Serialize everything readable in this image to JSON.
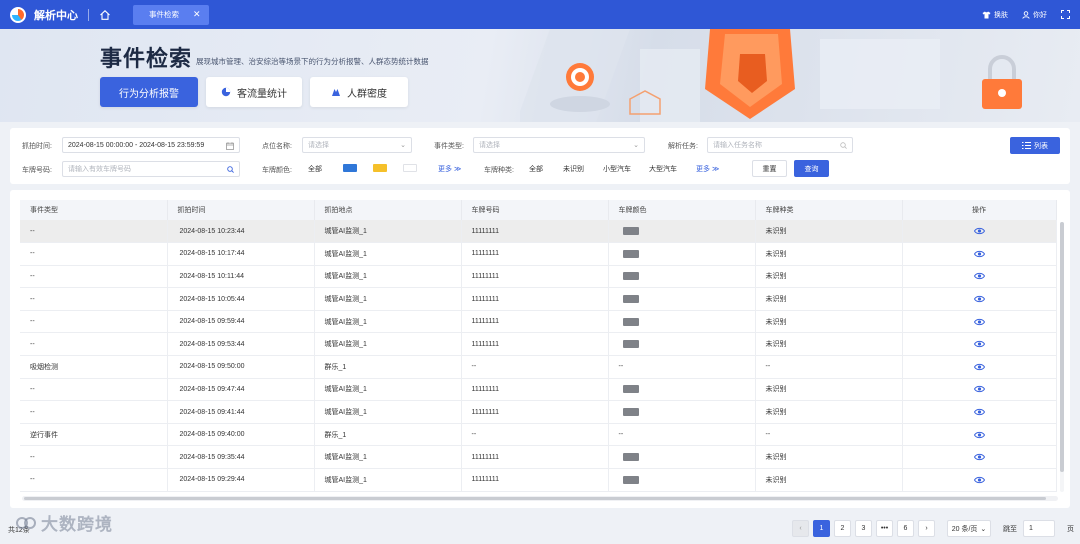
{
  "app": {
    "title": "解析中心",
    "active_tab": "事件检索"
  },
  "topbar": {
    "skin_label": "换肤",
    "user_label": "你好"
  },
  "banner": {
    "title": "事件检索",
    "subtitle": "展现城市管理、治安综治等场景下的行为分析报警、人群态势统计数据",
    "buttons": [
      "行为分析报警",
      "客流量统计",
      "人群密度"
    ]
  },
  "filters": {
    "time_label": "抓拍时间:",
    "time_value": "2024-08-15 00:00:00 - 2024-08-15 23:59:59",
    "point_label": "点位名称:",
    "point_placeholder": "请选择",
    "event_type_label": "事件类型:",
    "event_type_placeholder": "请选择",
    "task_label": "解析任务:",
    "task_placeholder": "请输入任务名称",
    "plate_label": "车牌号码:",
    "plate_placeholder": "请输入有效车牌号码",
    "plate_color_label": "车牌颜色:",
    "plate_color_all": "全部",
    "plate_colors": [
      "#2f77d8",
      "#f5c02a",
      "#ffffff"
    ],
    "more_label": "更多",
    "plate_kind_label": "车牌种类:",
    "plate_kinds": [
      "全部",
      "未识别",
      "小型汽车",
      "大型汽车"
    ],
    "reset_label": "重置",
    "search_label": "查询",
    "list_label": "列表"
  },
  "table": {
    "columns": [
      "事件类型",
      "抓拍时间",
      "抓拍地点",
      "车牌号码",
      "车牌颜色",
      "车牌种类",
      "操作"
    ],
    "rows": [
      {
        "type": "--",
        "time": "2024-08-15 10:23:44",
        "place": "城管AI监测_1",
        "plate": "11111111",
        "plate_color": true,
        "kind": "未识别"
      },
      {
        "type": "--",
        "time": "2024-08-15 10:17:44",
        "place": "城管AI监测_1",
        "plate": "11111111",
        "plate_color": true,
        "kind": "未识别"
      },
      {
        "type": "--",
        "time": "2024-08-15 10:11:44",
        "place": "城管AI监测_1",
        "plate": "11111111",
        "plate_color": true,
        "kind": "未识别"
      },
      {
        "type": "--",
        "time": "2024-08-15 10:05:44",
        "place": "城管AI监测_1",
        "plate": "11111111",
        "plate_color": true,
        "kind": "未识别"
      },
      {
        "type": "--",
        "time": "2024-08-15 09:59:44",
        "place": "城管AI监测_1",
        "plate": "11111111",
        "plate_color": true,
        "kind": "未识别"
      },
      {
        "type": "--",
        "time": "2024-08-15 09:53:44",
        "place": "城管AI监测_1",
        "plate": "11111111",
        "plate_color": true,
        "kind": "未识别"
      },
      {
        "type": "吸烟检测",
        "time": "2024-08-15 09:50:00",
        "place": "群乐_1",
        "plate": "--",
        "plate_color": false,
        "kind": "--"
      },
      {
        "type": "--",
        "time": "2024-08-15 09:47:44",
        "place": "城管AI监测_1",
        "plate": "11111111",
        "plate_color": true,
        "kind": "未识别"
      },
      {
        "type": "--",
        "time": "2024-08-15 09:41:44",
        "place": "城管AI监测_1",
        "plate": "11111111",
        "plate_color": true,
        "kind": "未识别"
      },
      {
        "type": "逆行事件",
        "time": "2024-08-15 09:40:00",
        "place": "群乐_1",
        "plate": "--",
        "plate_color": false,
        "kind": "--"
      },
      {
        "type": "--",
        "time": "2024-08-15 09:35:44",
        "place": "城管AI监测_1",
        "plate": "11111111",
        "plate_color": true,
        "kind": "未识别"
      },
      {
        "type": "--",
        "time": "2024-08-15 09:29:44",
        "place": "城管AI监测_1",
        "plate": "11111111",
        "plate_color": true,
        "kind": "未识别"
      }
    ],
    "empty_value": "--"
  },
  "pagination": {
    "total_label": "共12条",
    "pages": [
      "1",
      "2",
      "3",
      "•••",
      "6"
    ],
    "current": "1",
    "page_size": "20 条/页",
    "jump_label": "跳至",
    "jump_value": "1",
    "page_suffix": "页"
  },
  "watermark": "大数跨境",
  "colors": {
    "primary": "#3a63de",
    "topbar": "#2f57d6",
    "accent": "#ff6a2b"
  }
}
